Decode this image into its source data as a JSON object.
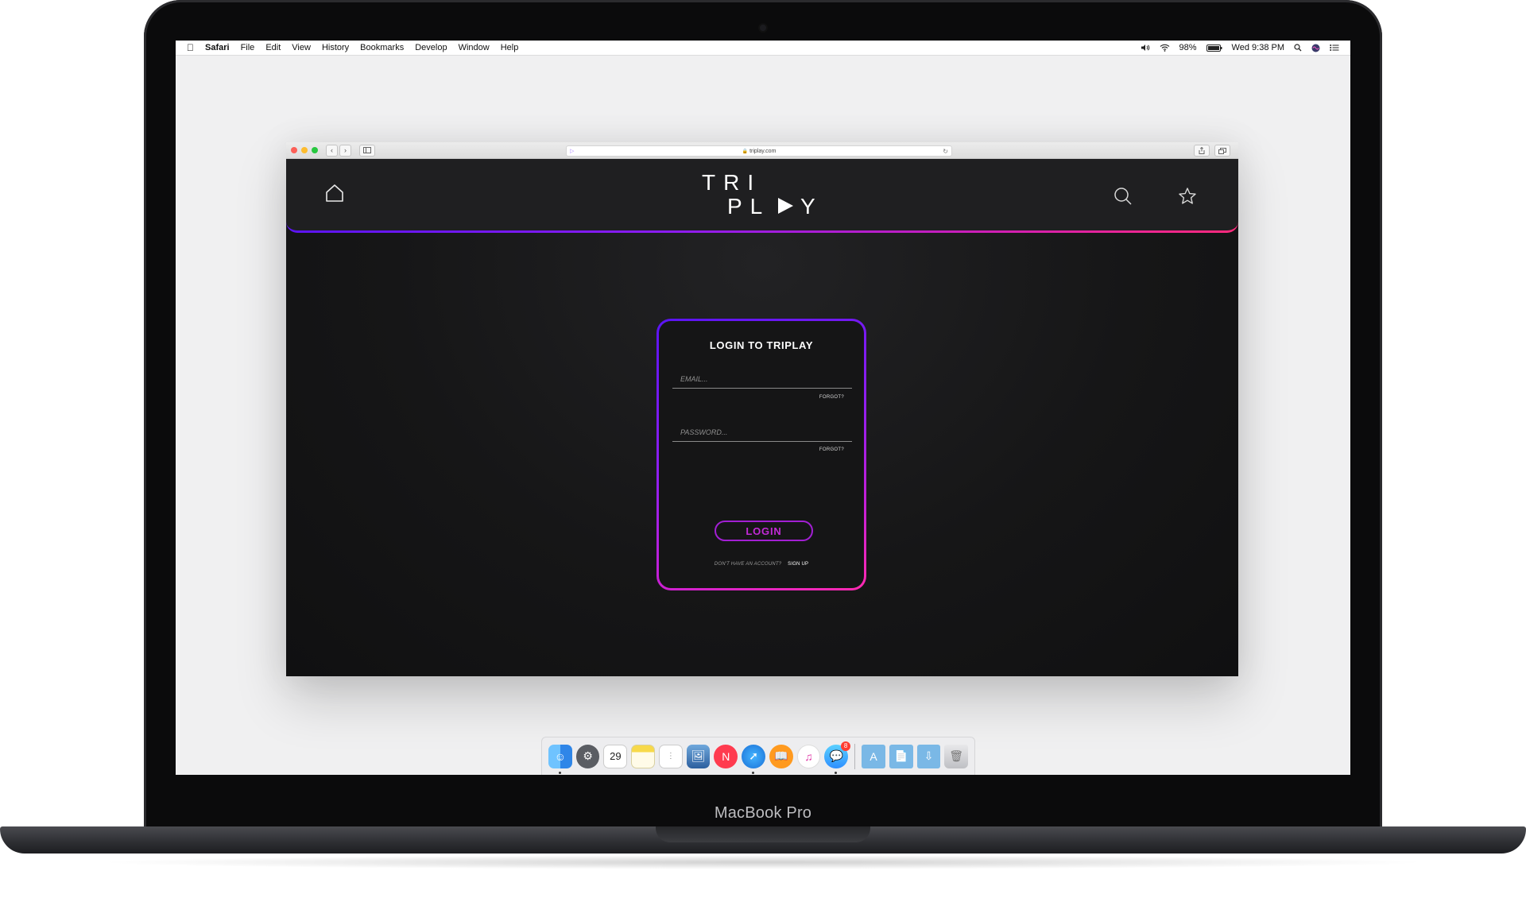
{
  "device": {
    "label": "MacBook Pro"
  },
  "menubar": {
    "app_name": "Safari",
    "menus": [
      "File",
      "Edit",
      "View",
      "History",
      "Bookmarks",
      "Develop",
      "Window",
      "Help"
    ],
    "battery": "98%",
    "clock": "Wed 9:38 PM"
  },
  "browser": {
    "url": "triplay.com"
  },
  "site": {
    "logo_line1": "TRI",
    "logo_line2": "PL",
    "logo_y": "Y",
    "login": {
      "title": "LOGIN TO TRIPLAY",
      "email_placeholder": "EMAIL...",
      "password_placeholder": "PASSWORD...",
      "forgot_label": "FORGOT?",
      "button_label": "LOGIN",
      "no_account_text": "DON'T HAVE AN ACCOUNT?",
      "signup_label": "SIGN UP"
    },
    "gradient_colors": [
      "#5b14f0",
      "#8b1cf0",
      "#d11fb3",
      "#ff2a7b"
    ]
  },
  "dock": {
    "calendar_day": "29",
    "messages_badge": "8",
    "apps": [
      "finder-icon",
      "system-preferences-icon",
      "calendar-icon",
      "notes-icon",
      "reminders-icon",
      "preview-icon",
      "news-icon",
      "safari-icon",
      "books-icon",
      "itunes-icon",
      "messages-icon",
      "applications-folder-icon",
      "documents-folder-icon",
      "downloads-folder-icon",
      "trash-icon"
    ]
  }
}
